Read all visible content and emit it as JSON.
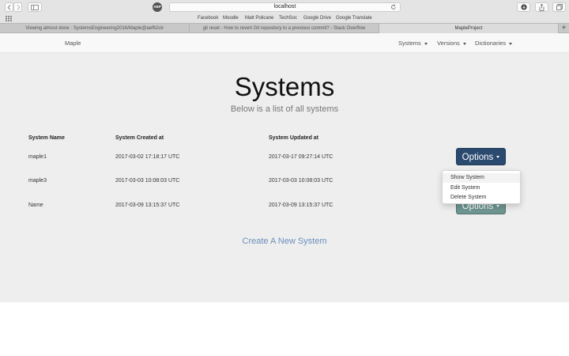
{
  "browser": {
    "url": "localhost",
    "favorites": [
      "Facebook",
      "Moodle",
      "Matt Policane",
      "TechSoc",
      "Google Drive",
      "Google Translate"
    ],
    "tabs": [
      {
        "label": "Viewing almost done · SystemsEngineering2016/Maple@aef62cb",
        "active": false
      },
      {
        "label": "git reset - How to revert Git repository to a previous commit? - Stack Overflow",
        "active": false
      },
      {
        "label": "MapleProject",
        "active": true
      }
    ],
    "shield_text": "ABP"
  },
  "navbar": {
    "brand": "Maple",
    "menus": [
      "Systems",
      "Versions",
      "Dictionaries"
    ]
  },
  "page": {
    "title": "Systems",
    "subtitle": "Below is a list of all systems",
    "table": {
      "headers": [
        "System Name",
        "System Created at",
        "System Updated at"
      ],
      "rows": [
        {
          "name": "maple1",
          "created": "2017-03-02 17:18:17 UTC",
          "updated": "2017-03-17 09:27:14 UTC"
        },
        {
          "name": "maple3",
          "created": "2017-03-03 10:08:03 UTC",
          "updated": "2017-03-03 10:08:03 UTC"
        },
        {
          "name": "Name",
          "created": "2017-03-09 13:15:37 UTC",
          "updated": "2017-03-09 13:15:37 UTC"
        }
      ]
    },
    "options_label": "Options",
    "dropdown": [
      "Show System",
      "Edit System",
      "Delete System"
    ],
    "create_link": "Create A New System"
  },
  "colors": {
    "options_primary": "#2b4a6f",
    "options_muted": "#6e9691",
    "link": "#6a8fbd"
  }
}
